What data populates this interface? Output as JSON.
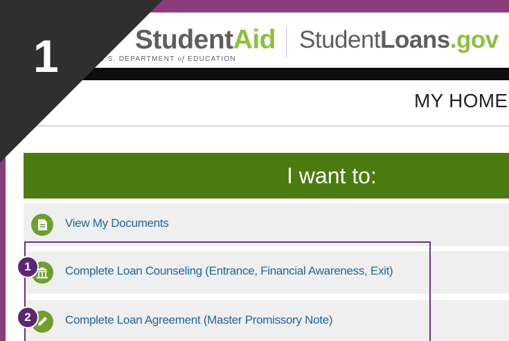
{
  "header": {
    "fsa_student": "Student",
    "fsa_aid": "Aid",
    "fsa_sub_prefix": "U.S. DEPARTMENT",
    "fsa_sub_of": "of",
    "fsa_sub_suffix": "EDUCATION",
    "sl_student": "Student",
    "sl_loans": "Loans",
    "sl_gov": ".gov"
  },
  "page": {
    "title": "MY HOME",
    "section_title": "I want to:"
  },
  "actions": [
    {
      "label": "View My Documents",
      "icon": "document-icon"
    },
    {
      "label": "Complete Loan Counseling (Entrance, Financial Awareness, Exit)",
      "icon": "bank-icon"
    },
    {
      "label": "Complete Loan Agreement (Master Promissory Note)",
      "icon": "pencil-icon"
    }
  ],
  "annotations": {
    "corner_step": "1",
    "callout_1": "1",
    "callout_2": "2"
  },
  "colors": {
    "frame": "#8b3a7b",
    "green_banner": "#4c7c0f",
    "icon_green": "#6e9f2f",
    "link_blue": "#22659c",
    "callout_purple": "#5b2775"
  }
}
